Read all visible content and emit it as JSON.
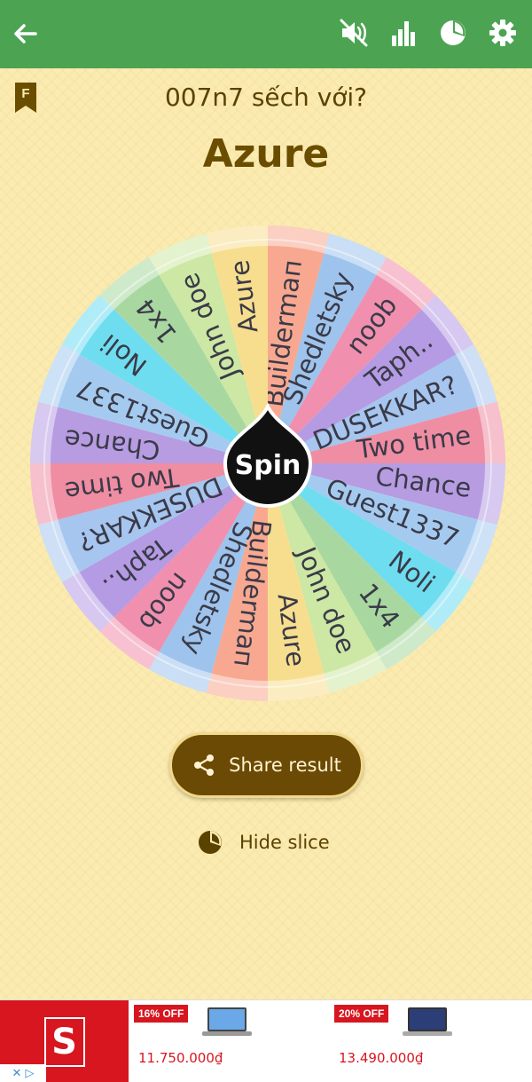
{
  "appbar": {
    "color": "#4CA453",
    "icons": [
      "back-arrow-icon",
      "mute-icon",
      "stats-icon",
      "pie-icon",
      "gear-icon"
    ]
  },
  "header": {
    "bookmark_letter": "F",
    "question": "007n7 sếch với?",
    "result": "Azure"
  },
  "wheel": {
    "center_label": "Spin",
    "slices": [
      {
        "label": "Buildermaп",
        "color": "#F8A890"
      },
      {
        "label": "Shedletsky",
        "color": "#9EC3EC"
      },
      {
        "label": "noob",
        "color": "#F08FAE"
      },
      {
        "label": "Taph..",
        "color": "#B59BE3"
      },
      {
        "label": "DUSEKKAR?",
        "color": "#A6C5EF"
      },
      {
        "label": "Two time",
        "color": "#EF8DA3"
      },
      {
        "label": "Chance",
        "color": "#B79CE2"
      },
      {
        "label": "Guest1337",
        "color": "#A4CBEF"
      },
      {
        "label": "Noli",
        "color": "#6FDDF0"
      },
      {
        "label": "1x4",
        "color": "#A8D8A0"
      },
      {
        "label": "John doe",
        "color": "#CDE7A4"
      },
      {
        "label": "Azure",
        "color": "#F7DE8E"
      }
    ]
  },
  "actions": {
    "share_label": "Share result",
    "hide_label": "Hide slice"
  },
  "ad": {
    "logo_letter": "S",
    "products": [
      {
        "discount": "16% OFF",
        "price": "11.750.000₫"
      },
      {
        "discount": "20% OFF",
        "price": "13.490.000₫"
      }
    ]
  }
}
